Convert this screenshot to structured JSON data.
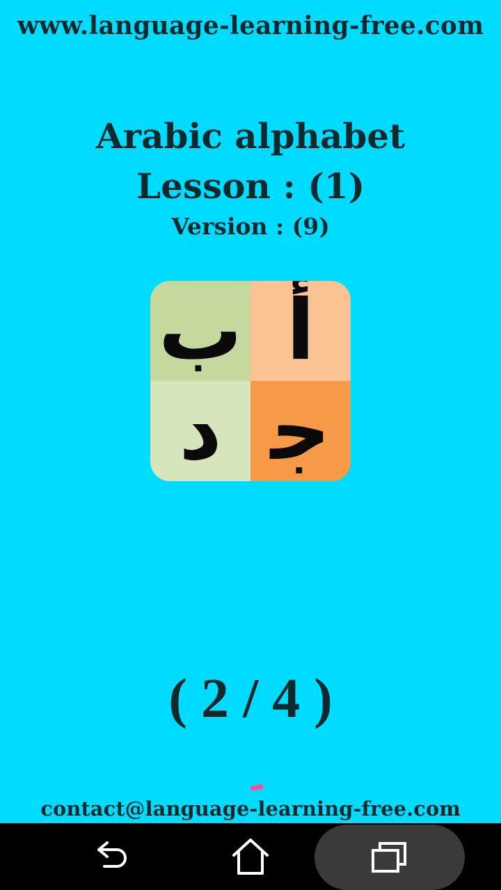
{
  "header": {
    "site_url": "www.language-learning-free.com"
  },
  "lesson": {
    "title": "Arabic alphabet",
    "lesson_label": "Lesson : (1)",
    "version_label": "Version : (9)"
  },
  "icon_grid": {
    "cells": [
      {
        "letter": "ب",
        "color": "#C5D99E"
      },
      {
        "letter": "أ",
        "color": "#FAC394"
      },
      {
        "letter": "د",
        "color": "#D6E5BB"
      },
      {
        "letter": "ﺟ",
        "color": "#F79A48"
      }
    ]
  },
  "progress": {
    "text": "( 2 / 4 )",
    "current": 2,
    "total": 4
  },
  "footer": {
    "contact": "contact@language-learning-free.com"
  },
  "navbar": {
    "back_icon": "back-icon",
    "home_icon": "home-icon",
    "recents_icon": "recents-icon"
  },
  "colors": {
    "background": "#00DCFF",
    "text": "#0F2A2E",
    "navbar": "#000000"
  }
}
